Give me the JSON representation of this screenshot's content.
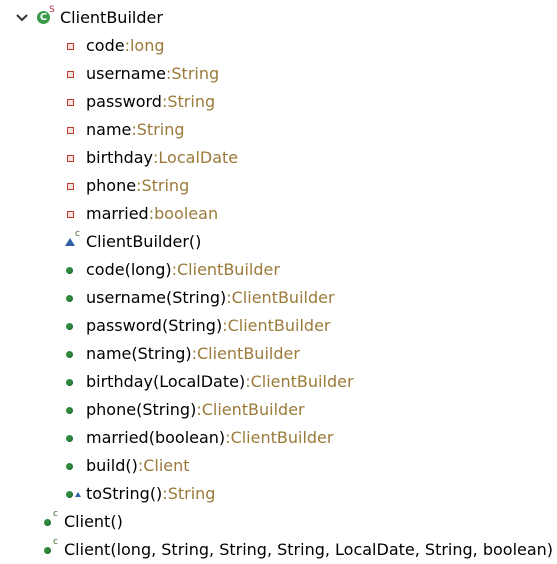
{
  "outline": {
    "class_node": {
      "name": "ClientBuilder",
      "icon": "static-class-icon",
      "expanded": true,
      "icon_badge": "S"
    },
    "fields": [
      {
        "name": "code",
        "sep": " : ",
        "type": "long"
      },
      {
        "name": "username",
        "sep": " : ",
        "type": "String"
      },
      {
        "name": "password",
        "sep": " : ",
        "type": "String"
      },
      {
        "name": "name",
        "sep": " : ",
        "type": "String"
      },
      {
        "name": "birthday",
        "sep": " : ",
        "type": "LocalDate"
      },
      {
        "name": "phone",
        "sep": " : ",
        "type": "String"
      },
      {
        "name": "married",
        "sep": " : ",
        "type": "boolean"
      }
    ],
    "constructor": {
      "name": "ClientBuilder()",
      "badge": "c"
    },
    "methods": [
      {
        "name": "code(long)",
        "sep": " : ",
        "type": "ClientBuilder"
      },
      {
        "name": "username(String)",
        "sep": " : ",
        "type": "ClientBuilder"
      },
      {
        "name": "password(String)",
        "sep": " : ",
        "type": "ClientBuilder"
      },
      {
        "name": "name(String)",
        "sep": " : ",
        "type": "ClientBuilder"
      },
      {
        "name": "birthday(LocalDate)",
        "sep": " : ",
        "type": "ClientBuilder"
      },
      {
        "name": "phone(String)",
        "sep": " : ",
        "type": "ClientBuilder"
      },
      {
        "name": "married(boolean)",
        "sep": " : ",
        "type": "ClientBuilder"
      },
      {
        "name": "build()",
        "sep": " : ",
        "type": "Client"
      },
      {
        "name": "toString()",
        "sep": " : ",
        "type": "String"
      }
    ],
    "outer_constructors": [
      {
        "name": "Client()",
        "badge": "c"
      },
      {
        "name": "Client(long, String, String, String, LocalDate, String, boolean)",
        "badge": "c"
      }
    ]
  },
  "colors": {
    "public_method": "#2e8b3e",
    "private_field": "#c0392b",
    "protected": "#2f5fa8",
    "type_text": "#9b7a3a"
  }
}
